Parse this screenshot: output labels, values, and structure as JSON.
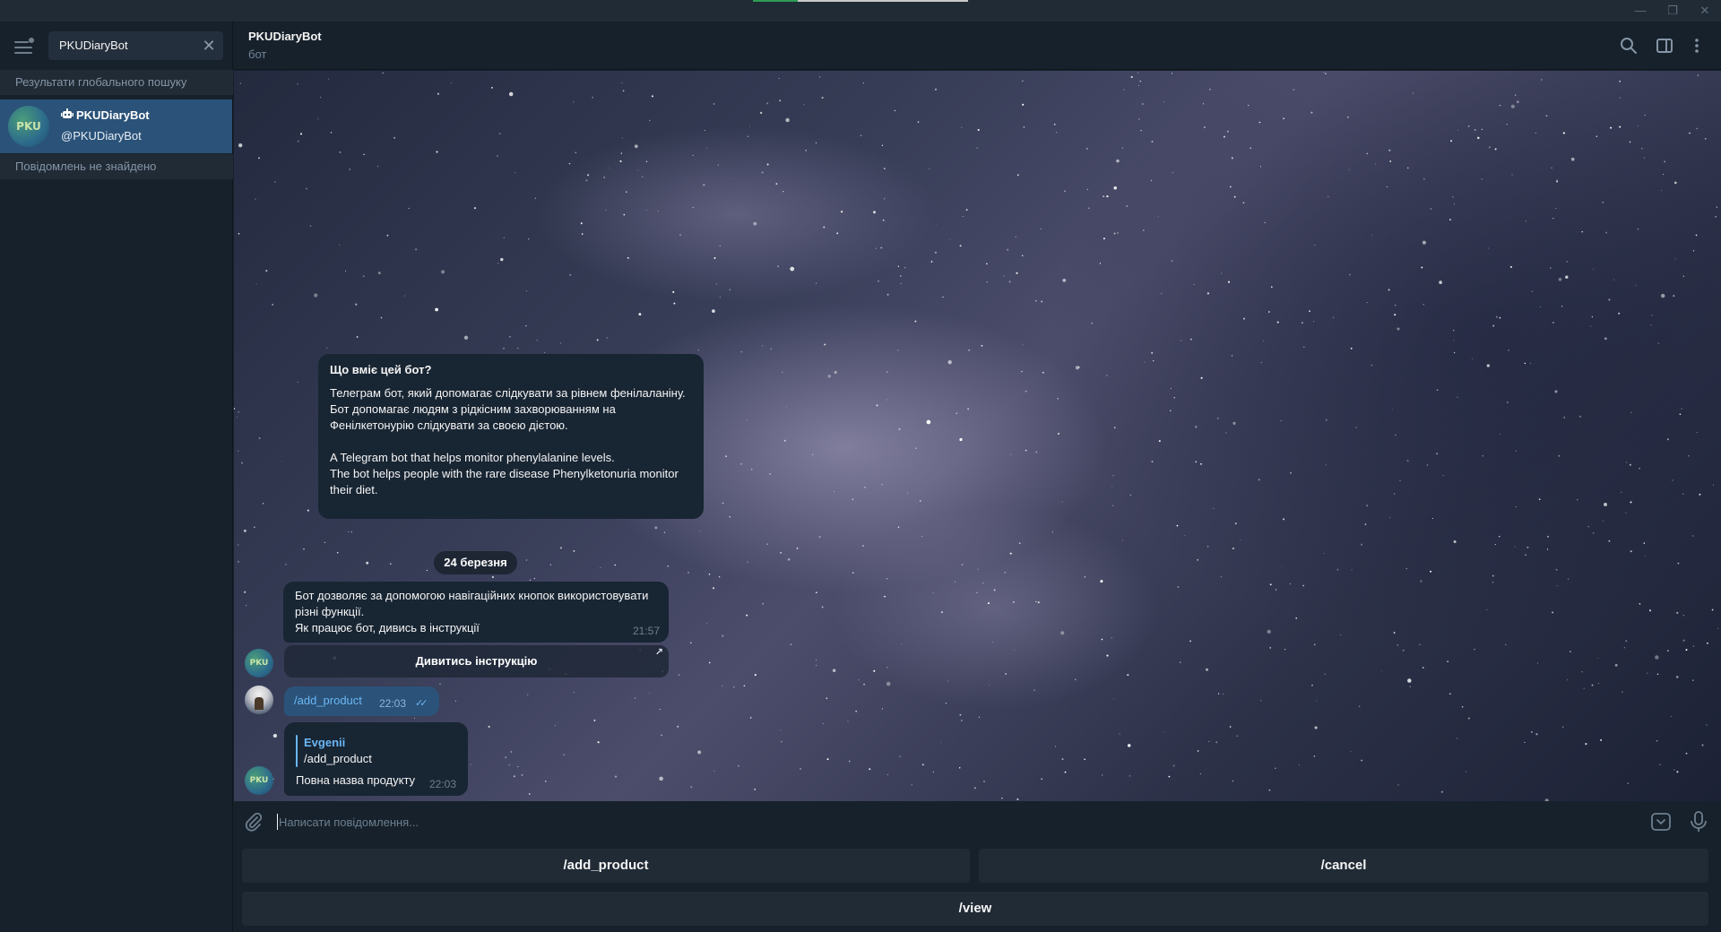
{
  "window": {
    "minimize_glyph": "—",
    "maximize_glyph": "❐",
    "close_glyph": "✕"
  },
  "sidebar": {
    "search_value": "PKUDiaryBot",
    "global_results_label": "Результати глобального пошуку",
    "result": {
      "name": "PKUDiaryBot",
      "handle": "@PKUDiaryBot",
      "avatar_text": "PKU"
    },
    "no_messages_label": "Повідомлень не знайдено"
  },
  "header": {
    "title": "PKUDiaryBot",
    "status": "бот"
  },
  "chat": {
    "info_card": {
      "title": "Що вміє цей бот?",
      "body": "Телеграм бот, який допомагає слідкувати за рівнем фенілаланіну.\nБот допомагає людям з рідкісним захворюванням на Фенілкетонурію слідкувати за своєю дієтою.\n\nA Telegram bot that helps monitor phenylalanine levels.\nThe bot helps people with the rare disease Phenylketonuria monitor their diet."
    },
    "date_label": "24 березня",
    "messages": [
      {
        "text": "Бот дозволяє за допомогою навігаційних кнопок використовувати різні функції.\nЯк працює бот, дивись в інструкції",
        "time": "21:57",
        "inline_button": "Дивитись інструкцію",
        "avatar_text": "PKU"
      },
      {
        "text": "/add_product",
        "time": "22:03",
        "ticks": "✓✓"
      },
      {
        "reply_name": "Evgenii",
        "reply_text": "/add_product",
        "text": "Повна назва продукту",
        "time": "22:03",
        "avatar_text": "PKU"
      }
    ]
  },
  "composer": {
    "placeholder": "Написати повідомлення..."
  },
  "reply_keyboard": {
    "buttons": [
      "/add_product",
      "/cancel",
      "/view"
    ]
  },
  "colors": {
    "accent": "#6ab7f5",
    "selected": "#2b5278",
    "panel": "#17212b",
    "bubble": "#182533"
  }
}
